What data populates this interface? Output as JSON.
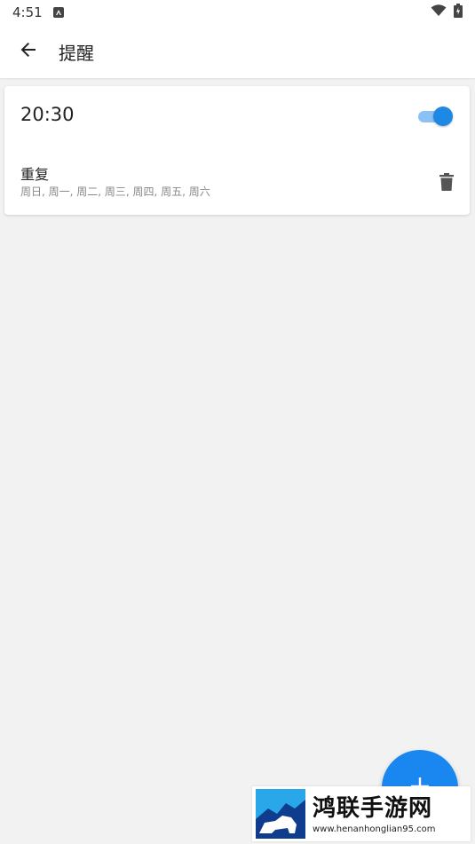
{
  "status_bar": {
    "time": "4:51",
    "notification_icon": "a-badge-icon",
    "wifi_icon": "wifi-icon",
    "battery_icon": "battery-icon"
  },
  "app_bar": {
    "back_icon": "arrow-left-icon",
    "title": "提醒"
  },
  "reminder": {
    "time": "20:30",
    "enabled": true,
    "repeat_label": "重复",
    "repeat_days": "周日, 周一, 周二, 周三, 周四, 周五, 周六",
    "delete_icon": "trash-icon"
  },
  "fab": {
    "icon": "plus-icon"
  },
  "watermark": {
    "name": "鸿联手游网",
    "url": "www.henanhonglian95.com"
  },
  "colors": {
    "accent": "#1e88e5",
    "toggle_track": "#8cc1f5",
    "background": "#f2f2f2"
  }
}
